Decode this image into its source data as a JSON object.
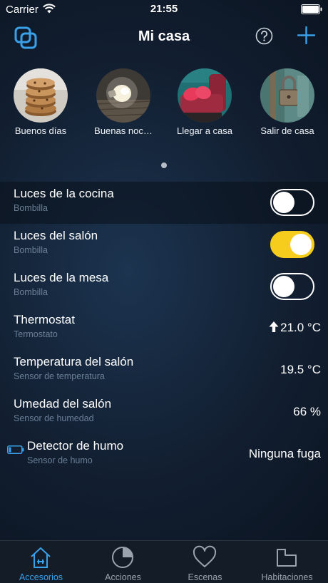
{
  "status_bar": {
    "carrier": "Carrier",
    "time": "21:55"
  },
  "nav": {
    "title": "Mi casa",
    "icons": {
      "home": "homes-icon",
      "help": "help-icon",
      "add": "add-icon"
    },
    "accent_color": "#3aa0e8"
  },
  "scenes": [
    {
      "label": "Buenos días",
      "icon": "cookies-photo"
    },
    {
      "label": "Buenas noc…",
      "icon": "lightbulb-photo"
    },
    {
      "label": "Llegar a casa",
      "icon": "sofa-photo"
    },
    {
      "label": "Salir de casa",
      "icon": "padlock-photo"
    }
  ],
  "accessories": [
    {
      "name": "Luces de la cocina",
      "type": "Bombilla",
      "control": "toggle",
      "on": false
    },
    {
      "name": "Luces del salón",
      "type": "Bombilla",
      "control": "toggle",
      "on": true
    },
    {
      "name": "Luces de la mesa",
      "type": "Bombilla",
      "control": "toggle",
      "on": false
    },
    {
      "name": "Thermostat",
      "type": "Termostato",
      "value": "21.0 °C",
      "icon": "arrow-up-icon"
    },
    {
      "name": "Temperatura del salón",
      "type": "Sensor de temperatura",
      "value": "19.5 °C"
    },
    {
      "name": "Umedad del salón",
      "type": "Sensor de humedad",
      "value": "66 %"
    },
    {
      "name": "Detector de humo",
      "type": "Sensor de humo",
      "value": "Ninguna fuga",
      "icon": "battery-low-icon"
    }
  ],
  "tabs": [
    {
      "label": "Accesorios",
      "icon": "house-icon",
      "active": true
    },
    {
      "label": "Acciones",
      "icon": "pie-icon",
      "active": false
    },
    {
      "label": "Escenas",
      "icon": "heart-icon",
      "active": false
    },
    {
      "label": "Habitaciones",
      "icon": "rooms-icon",
      "active": false
    }
  ],
  "colors": {
    "toggle_on": "#f6cd1c",
    "tab_active": "#3aa0e8",
    "tab_inactive": "#9aa3ae",
    "subtitle": "#6a7f96"
  }
}
